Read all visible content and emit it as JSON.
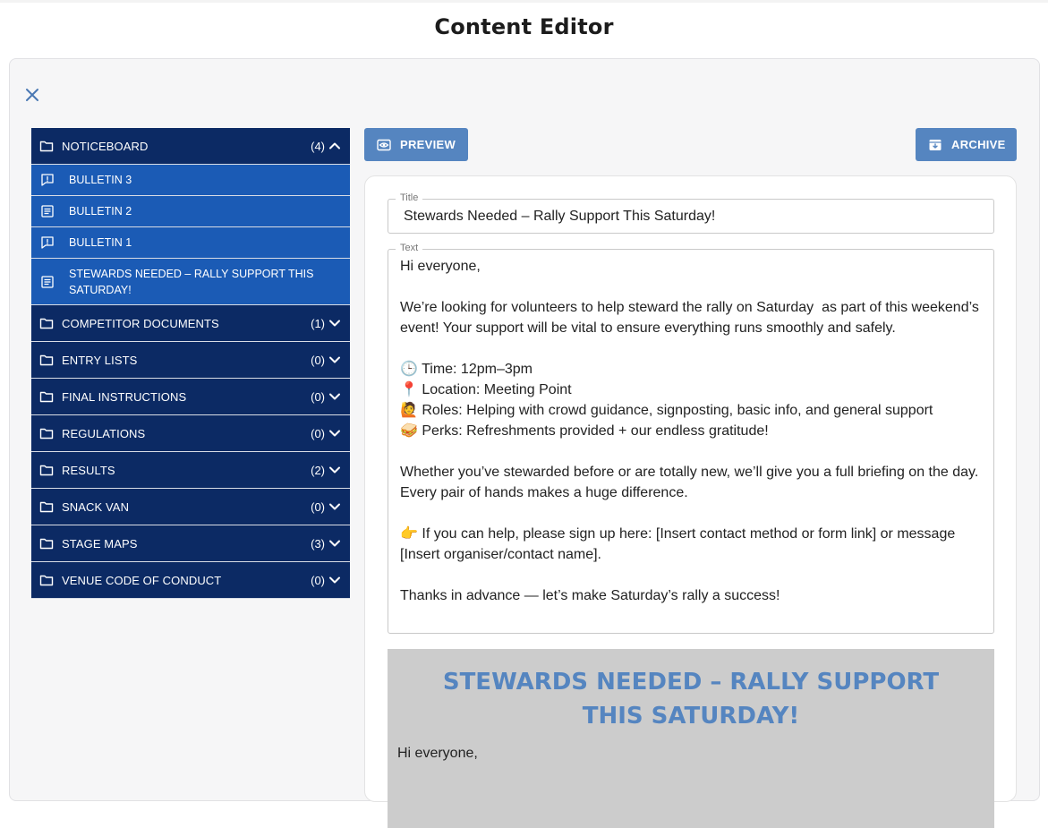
{
  "page": {
    "title": "Content Editor"
  },
  "colors": {
    "folder_bg": "#0c2a64",
    "item_bg": "#1b5bb5",
    "button_bg": "#5585c0",
    "preview_bg": "#cccccc",
    "accent": "#5585c0"
  },
  "sidebar": {
    "open_folder": {
      "label": "NOTICEBOARD",
      "count": "(4)",
      "icon": "folder-icon",
      "chevron": "chevron-up-icon"
    },
    "items": [
      {
        "label": "BULLETIN 3",
        "icon": "comment-icon"
      },
      {
        "label": "BULLETIN 2",
        "icon": "article-icon"
      },
      {
        "label": "BULLETIN 1",
        "icon": "comment-icon"
      },
      {
        "label": "STEWARDS NEEDED – RALLY SUPPORT THIS SATURDAY!",
        "icon": "article-icon"
      }
    ],
    "folders": [
      {
        "label": "COMPETITOR DOCUMENTS",
        "count": "(1)"
      },
      {
        "label": "ENTRY LISTS",
        "count": "(0)"
      },
      {
        "label": "FINAL INSTRUCTIONS",
        "count": "(0)"
      },
      {
        "label": "REGULATIONS",
        "count": "(0)"
      },
      {
        "label": "RESULTS",
        "count": "(2)"
      },
      {
        "label": "SNACK VAN",
        "count": "(0)"
      },
      {
        "label": "STAGE MAPS",
        "count": "(3)"
      },
      {
        "label": "VENUE CODE OF CONDUCT",
        "count": "(0)"
      }
    ]
  },
  "toolbar": {
    "preview_label": "PREVIEW",
    "archive_label": "ARCHIVE"
  },
  "editor": {
    "title_legend": "Title",
    "title_value": "Stewards Needed – Rally Support This Saturday!",
    "text_legend": "Text",
    "text_value": "Hi everyone,\n\nWe’re looking for volunteers to help steward the rally on Saturday  as part of this weekend’s event! Your support will be vital to ensure everything runs smoothly and safely.\n\n🕒 Time: 12pm–3pm\n📍 Location: Meeting Point\n🙋 Roles: Helping with crowd guidance, signposting, basic info, and general support\n🥪 Perks: Refreshments provided + our endless gratitude!\n\nWhether you’ve stewarded before or are totally new, we’ll give you a full briefing on the day. Every pair of hands makes a huge difference.\n\n👉 If you can help, please sign up here: [Insert contact method or form link] or message [Insert organiser/contact name].\n\nThanks in advance — let’s make Saturday’s rally a success!"
  },
  "preview": {
    "title": "STEWARDS NEEDED – RALLY SUPPORT THIS SATURDAY!",
    "first_line": "Hi everyone,"
  }
}
